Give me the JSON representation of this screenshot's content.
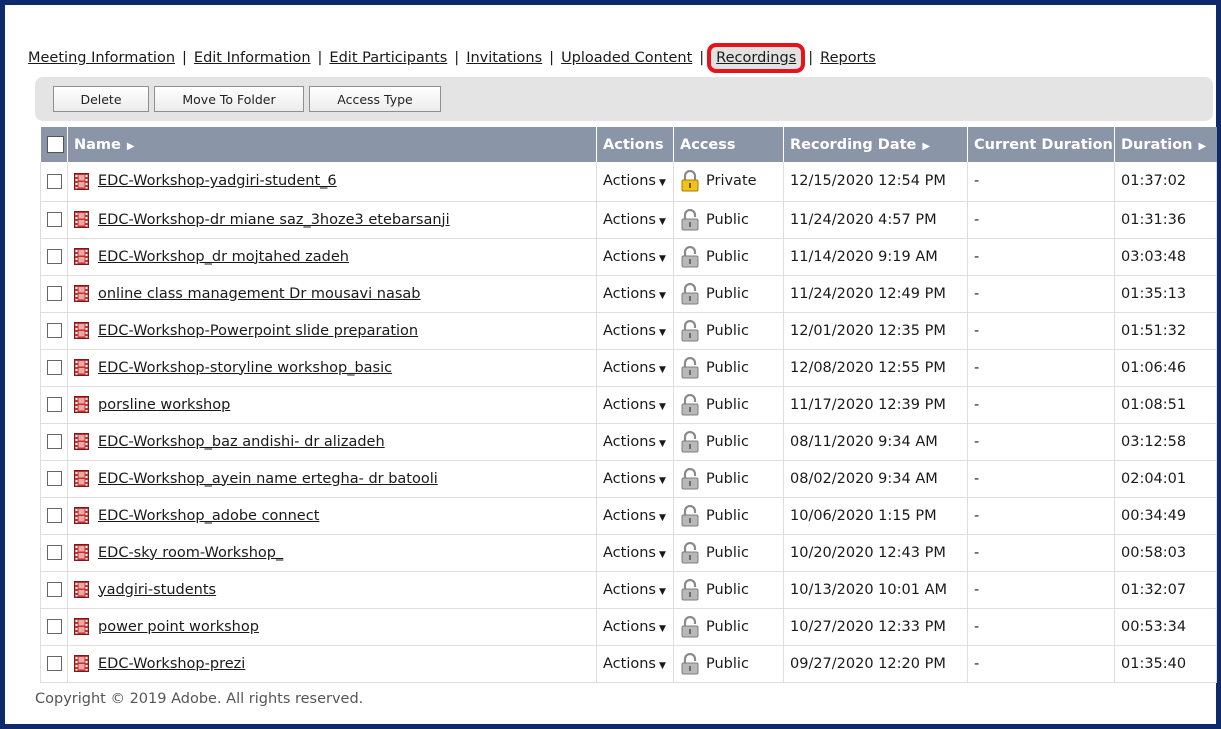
{
  "tabs": [
    {
      "label": "Meeting Information",
      "selected": false
    },
    {
      "label": "Edit Information",
      "selected": false
    },
    {
      "label": "Edit Participants",
      "selected": false
    },
    {
      "label": "Invitations",
      "selected": false
    },
    {
      "label": "Uploaded Content",
      "selected": false
    },
    {
      "label": "Recordings",
      "selected": true
    },
    {
      "label": "Reports",
      "selected": false
    }
  ],
  "tab_separator": "|",
  "toolbar": {
    "delete_label": "Delete",
    "move_label": "Move To Folder",
    "access_label": "Access Type"
  },
  "table": {
    "headers": {
      "name": "Name",
      "actions": "Actions",
      "access": "Access",
      "recording_date": "Recording Date",
      "current_duration": "Current Duration",
      "duration": "Duration"
    },
    "sort_arrow": "▶",
    "rows": [
      {
        "name": "EDC-Workshop-yadgiri-student_6",
        "actions": "Actions",
        "access": "Private",
        "access_type": "private",
        "date": "12/15/2020 12:54 PM",
        "current_duration": "-",
        "duration": "01:37:02"
      },
      {
        "name": "EDC-Workshop-dr miane saz_3hoze3 etebarsanji",
        "actions": "Actions",
        "access": "Public",
        "access_type": "public",
        "date": "11/24/2020 4:57 PM",
        "current_duration": "-",
        "duration": "01:31:36"
      },
      {
        "name": "EDC-Workshop_dr mojtahed zadeh",
        "actions": "Actions",
        "access": "Public",
        "access_type": "public",
        "date": "11/14/2020 9:19 AM",
        "current_duration": "-",
        "duration": "03:03:48"
      },
      {
        "name": "online class management Dr mousavi nasab",
        "actions": "Actions",
        "access": "Public",
        "access_type": "public",
        "date": "11/24/2020 12:49 PM",
        "current_duration": "-",
        "duration": "01:35:13"
      },
      {
        "name": "EDC-Workshop-Powerpoint slide preparation",
        "actions": "Actions",
        "access": "Public",
        "access_type": "public",
        "date": "12/01/2020 12:35 PM",
        "current_duration": "-",
        "duration": "01:51:32"
      },
      {
        "name": "EDC-Workshop-storyline workshop_basic",
        "actions": "Actions",
        "access": "Public",
        "access_type": "public",
        "date": "12/08/2020 12:55 PM",
        "current_duration": "-",
        "duration": "01:06:46"
      },
      {
        "name": "porsline workshop",
        "actions": "Actions",
        "access": "Public",
        "access_type": "public",
        "date": "11/17/2020 12:39 PM",
        "current_duration": "-",
        "duration": "01:08:51"
      },
      {
        "name": "EDC-Workshop_baz andishi- dr alizadeh",
        "actions": "Actions",
        "access": "Public",
        "access_type": "public",
        "date": "08/11/2020 9:34 AM",
        "current_duration": "-",
        "duration": "03:12:58"
      },
      {
        "name": "EDC-Workshop_ayein name ertegha- dr batooli",
        "actions": "Actions",
        "access": "Public",
        "access_type": "public",
        "date": "08/02/2020 9:34 AM",
        "current_duration": "-",
        "duration": "02:04:01"
      },
      {
        "name": "EDC-Workshop_adobe connect",
        "actions": "Actions",
        "access": "Public",
        "access_type": "public",
        "date": "10/06/2020 1:15 PM",
        "current_duration": "-",
        "duration": "00:34:49"
      },
      {
        "name": "EDC-sky room-Workshop_",
        "actions": "Actions",
        "access": "Public",
        "access_type": "public",
        "date": "10/20/2020 12:43 PM",
        "current_duration": "-",
        "duration": "00:58:03"
      },
      {
        "name": "yadgiri-students",
        "actions": "Actions",
        "access": "Public",
        "access_type": "public",
        "date": "10/13/2020 10:01 AM",
        "current_duration": "-",
        "duration": "01:32:07"
      },
      {
        "name": "power point workshop",
        "actions": "Actions",
        "access": "Public",
        "access_type": "public",
        "date": "10/27/2020 12:33 PM",
        "current_duration": "-",
        "duration": "00:53:34"
      },
      {
        "name": "EDC-Workshop-prezi",
        "actions": "Actions",
        "access": "Public",
        "access_type": "public",
        "date": "09/27/2020 12:20 PM",
        "current_duration": "-",
        "duration": "01:35:40"
      }
    ]
  },
  "footer": {
    "copyright": "Copyright © 2019 Adobe. All rights reserved."
  },
  "colors": {
    "frame_border": "#0e2a6b",
    "header_bg": "#8a95a8",
    "highlight": "#e8121b",
    "toolbar_bg": "#e4e4e4"
  },
  "icons": {
    "recording": "film-recording-icon",
    "private": "lock-closed-icon",
    "public": "lock-open-icon"
  }
}
